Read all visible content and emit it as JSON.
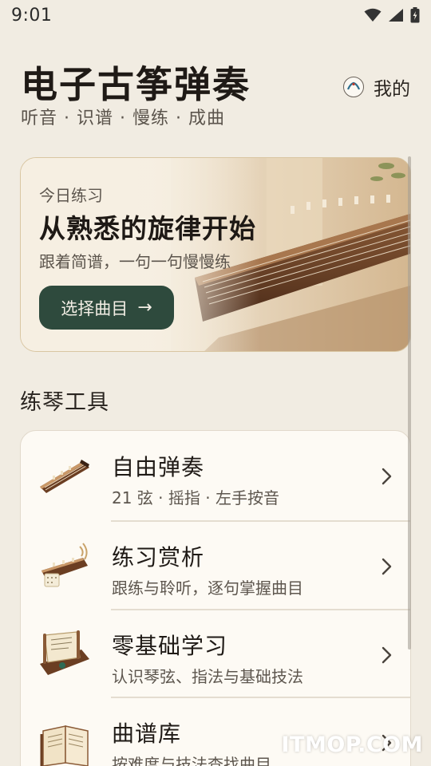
{
  "status_bar": {
    "time": "9:01",
    "icons": [
      "wifi-icon",
      "cell-signal-icon",
      "battery-charging-icon"
    ]
  },
  "header": {
    "title": "电子古筝弹奏",
    "subtitle": "听音 · 识谱 · 慢练 · 成曲",
    "profile_label": "我的",
    "profile_icon": "avatar-icon"
  },
  "hero": {
    "eyebrow": "今日练习",
    "title": "从熟悉的旋律开始",
    "description": "跟着简谱，一句一句慢慢练",
    "button_label": "选择曲目",
    "button_arrow": "→",
    "image": "guzheng-photo"
  },
  "tools": {
    "section_title": "练琴工具",
    "items": [
      {
        "title": "自由弹奏",
        "description": "21 弦 · 摇指 · 左手按音",
        "icon": "guzheng-icon"
      },
      {
        "title": "练习赏析",
        "description": "跟练与聆听，逐句掌握曲目",
        "icon": "guzheng-listening-icon"
      },
      {
        "title": "零基础学习",
        "description": "认识琴弦、指法与基础技法",
        "icon": "scroll-lesson-icon"
      },
      {
        "title": "曲谱库",
        "description": "按难度与技法查找曲目",
        "icon": "book-icon"
      }
    ]
  },
  "colors": {
    "background": "#f1ece2",
    "accent_button": "#2e4a3d",
    "card": "#fdfaf4"
  },
  "watermark": "ITMOP.COM"
}
